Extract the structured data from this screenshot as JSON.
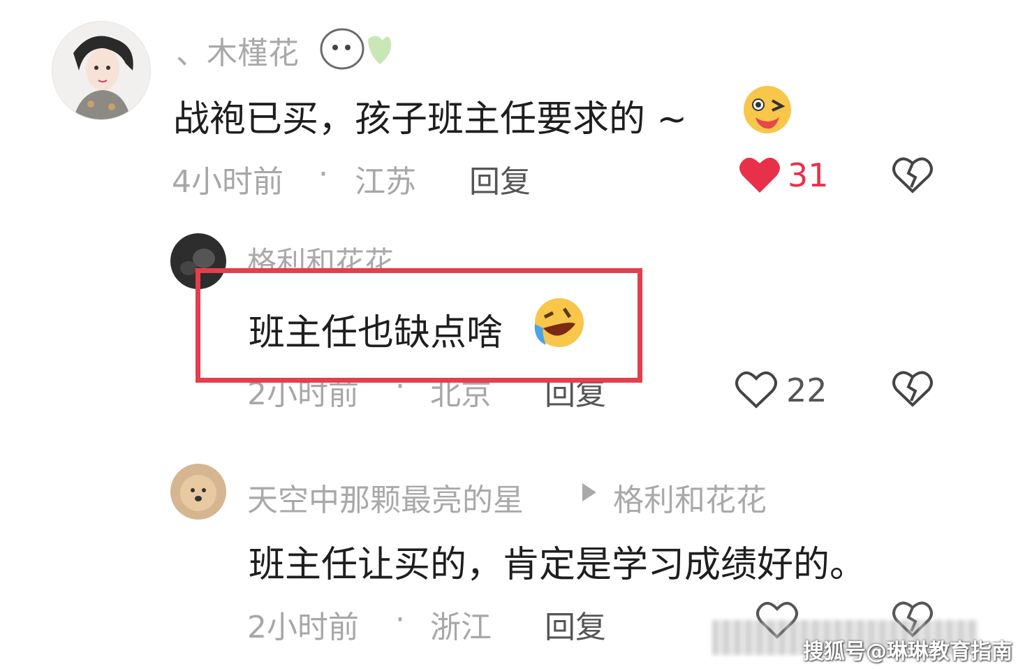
{
  "comments": [
    {
      "username": "、木槿花",
      "text": "战袍已买，孩子班主任要求的 ~",
      "time": "4小时前",
      "sep": "·",
      "location": "江苏",
      "reply_label": "回复",
      "likes": "31",
      "liked": true
    },
    {
      "username": "格利和花花",
      "text": "班主任也缺点啥",
      "time": "2小时前",
      "sep": "·",
      "location": "北京",
      "reply_label": "回复",
      "likes": "22",
      "liked": false
    },
    {
      "username": "天空中那颗最亮的星",
      "reply_to": "格利和花花",
      "text": "班主任让买的，肯定是学习成绩好的。",
      "time": "2小时前",
      "sep": "·",
      "location": "浙江",
      "reply_label": "回复",
      "likes": "",
      "liked": false
    }
  ],
  "watermark": "搜狐号@琳琳教育指南",
  "colors": {
    "like_active": "#e8304a",
    "highlight_box": "#e53e4c",
    "meta_gray": "#a7a7a7"
  }
}
